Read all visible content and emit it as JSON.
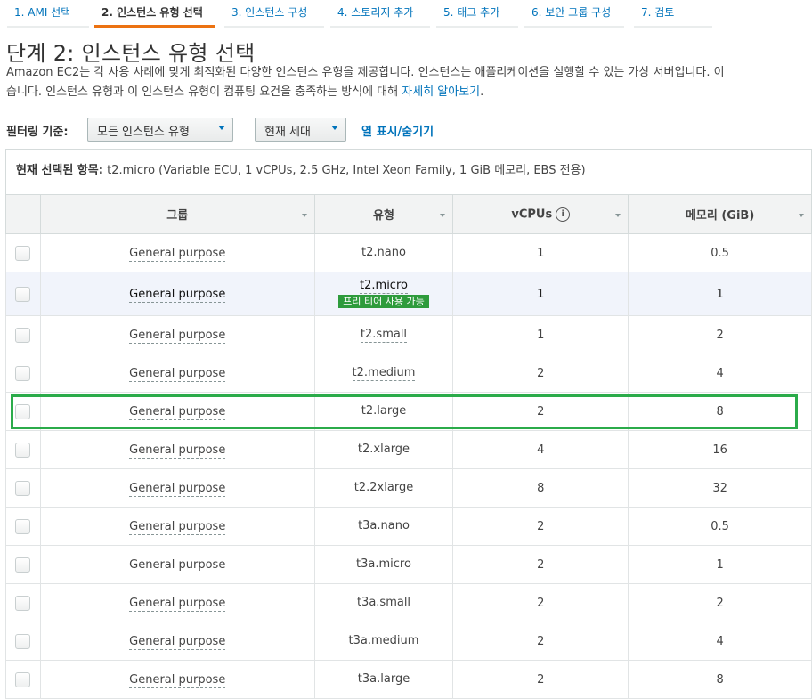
{
  "wizard": {
    "steps": [
      {
        "label": "1. AMI 선택"
      },
      {
        "label": "2. 인스턴스 유형 선택"
      },
      {
        "label": "3. 인스턴스 구성"
      },
      {
        "label": "4. 스토리지 추가"
      },
      {
        "label": "5. 태그 추가"
      },
      {
        "label": "6. 보안 그룹 구성"
      },
      {
        "label": "7. 검토"
      }
    ],
    "active_index": 1
  },
  "page": {
    "title": "단계 2: 인스턴스 유형 선택",
    "description_line1": "Amazon EC2는 각 사용 사례에 맞게 최적화된 다양한 인스턴스 유형을 제공합니다. 인스턴스는 애플리케이션을 실행할 수 있는 가상 서버입니다. 이",
    "description_line2": "습니다. 인스턴스 유형과 이 인스턴스 유형이 컴퓨팅 요건을 충족하는 방식에 대해 ",
    "learn_more": "자세히 알아보기",
    "learn_more_suffix": "."
  },
  "filter": {
    "label": "필터링 기준:",
    "type_select": "모든 인스턴스 유형",
    "generation_select": "현재 세대",
    "column_toggle": "열 표시/숨기기"
  },
  "selection": {
    "label": "현재 선택된 항목:",
    "value": " t2.micro (Variable ECU, 1 vCPUs, 2.5 GHz, Intel Xeon Family, 1 GiB 메모리, EBS 전용)"
  },
  "table": {
    "headers": {
      "group": "그룹",
      "type": "유형",
      "vcpus": "vCPUs",
      "memory": "메모리 (GiB)"
    },
    "free_tier_badge": "프리 티어 사용 가능",
    "rows": [
      {
        "group": "General purpose",
        "type": "t2.nano",
        "vcpus": "1",
        "memory": "0.5"
      },
      {
        "group": "General purpose",
        "type": "t2.micro",
        "vcpus": "1",
        "memory": "1",
        "selected": true,
        "free_tier": true
      },
      {
        "group": "General purpose",
        "type": "t2.small",
        "vcpus": "1",
        "memory": "2"
      },
      {
        "group": "General purpose",
        "type": "t2.medium",
        "vcpus": "2",
        "memory": "4"
      },
      {
        "group": "General purpose",
        "type": "t2.large",
        "vcpus": "2",
        "memory": "8",
        "highlighted": true
      },
      {
        "group": "General purpose",
        "type": "t2.xlarge",
        "vcpus": "4",
        "memory": "16"
      },
      {
        "group": "General purpose",
        "type": "t2.2xlarge",
        "vcpus": "8",
        "memory": "32"
      },
      {
        "group": "General purpose",
        "type": "t3a.nano",
        "vcpus": "2",
        "memory": "0.5"
      },
      {
        "group": "General purpose",
        "type": "t3a.micro",
        "vcpus": "2",
        "memory": "1"
      },
      {
        "group": "General purpose",
        "type": "t3a.small",
        "vcpus": "2",
        "memory": "2"
      },
      {
        "group": "General purpose",
        "type": "t3a.medium",
        "vcpus": "2",
        "memory": "4"
      },
      {
        "group": "General purpose",
        "type": "t3a.large",
        "vcpus": "2",
        "memory": "8"
      }
    ]
  },
  "colors": {
    "accent": "#ec7211",
    "link": "#0073bb",
    "free_tier": "#2e9b3c",
    "highlight": "#2bab4a"
  }
}
